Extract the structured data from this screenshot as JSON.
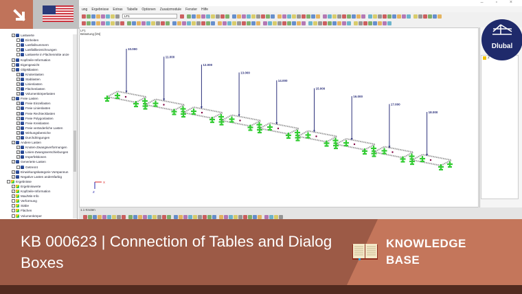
{
  "window": {
    "controls": "– ▫ ×"
  },
  "menu": [
    "ung",
    "Ergebnisse",
    "Extras",
    "Tabelle",
    "Optionen",
    "Zusatzmodule",
    "Fenster",
    "Hilfe"
  ],
  "toolbar": {
    "loadcase": "LF1"
  },
  "tree": [
    {
      "level": 1,
      "label": "Lastwerte",
      "checked": true,
      "icon": "load"
    },
    {
      "level": 2,
      "label": "Einheiten",
      "checked": false,
      "icon": "load"
    },
    {
      "level": 2,
      "label": "Lastfallnummern",
      "checked": false,
      "icon": "load"
    },
    {
      "level": 2,
      "label": "Lastfallbezeichnungen",
      "checked": false,
      "icon": "load"
    },
    {
      "level": 2,
      "label": "Lastwerte in Flächenmitte anze",
      "checked": false,
      "icon": "load"
    },
    {
      "level": 1,
      "label": "Kopfzeile-Information",
      "checked": true,
      "icon": "load"
    },
    {
      "level": 1,
      "label": "Eigengewicht",
      "checked": false,
      "icon": "load"
    },
    {
      "level": 1,
      "label": "Objektlasten",
      "checked": true,
      "icon": "load"
    },
    {
      "level": 2,
      "label": "Knotenlasten",
      "checked": true,
      "icon": "load"
    },
    {
      "level": 2,
      "label": "Stablasten",
      "checked": true,
      "icon": "load"
    },
    {
      "level": 2,
      "label": "Linienlasten",
      "checked": true,
      "icon": "load"
    },
    {
      "level": 2,
      "label": "Flächenlasten",
      "checked": true,
      "icon": "load"
    },
    {
      "level": 2,
      "label": "Volumenkörperlasten",
      "checked": true,
      "icon": "load"
    },
    {
      "level": 1,
      "label": "Freie Lasten",
      "checked": true,
      "icon": "load"
    },
    {
      "level": 2,
      "label": "Freie Einzellasten",
      "checked": true,
      "icon": "load"
    },
    {
      "level": 2,
      "label": "Freie Linienlasten",
      "checked": true,
      "icon": "load"
    },
    {
      "level": 2,
      "label": "Freie Rechtecklasten",
      "checked": true,
      "icon": "load"
    },
    {
      "level": 2,
      "label": "Freie Polygonlasten",
      "checked": true,
      "icon": "load"
    },
    {
      "level": 2,
      "label": "Freie Kreislasten",
      "checked": true,
      "icon": "load"
    },
    {
      "level": 2,
      "label": "Freie veränderliche Lasten",
      "checked": true,
      "icon": "load"
    },
    {
      "level": 2,
      "label": "Wirkungsbereiche",
      "checked": true,
      "icon": "load"
    },
    {
      "level": 2,
      "label": "Durchdringungen",
      "checked": true,
      "icon": "load"
    },
    {
      "level": 1,
      "label": "Andere Lasten",
      "checked": true,
      "icon": "load"
    },
    {
      "level": 2,
      "label": "Knoten-Zwangsverformungen",
      "checked": true,
      "icon": "load"
    },
    {
      "level": 2,
      "label": "Linien-Zwangsverschiebungen",
      "checked": true,
      "icon": "load"
    },
    {
      "level": 2,
      "label": "Imperfektionen",
      "checked": true,
      "icon": "load"
    },
    {
      "level": 1,
      "label": "Generierte Lasten",
      "checked": true,
      "icon": "load"
    },
    {
      "level": 2,
      "label": "Getrennt",
      "checked": false,
      "icon": "load"
    },
    {
      "level": 1,
      "label": "Einwirkungskategorie Vorspannun",
      "checked": true,
      "icon": "load"
    },
    {
      "level": 1,
      "label": "Negative Lasten andersfarbig",
      "checked": true,
      "icon": "load"
    },
    {
      "level": 0,
      "label": "Ergebnisse",
      "checked": false,
      "icon": "result"
    },
    {
      "level": 1,
      "label": "Ergebniswerte",
      "checked": true,
      "icon": "result"
    },
    {
      "level": 1,
      "label": "Kopfzeile-Information",
      "checked": true,
      "icon": "result"
    },
    {
      "level": 1,
      "label": "Max/Min-Info",
      "checked": true,
      "icon": "result"
    },
    {
      "level": 1,
      "label": "Verformung",
      "checked": false,
      "icon": "result"
    },
    {
      "level": 1,
      "label": "Stäbe",
      "checked": false,
      "icon": "result"
    },
    {
      "level": 1,
      "label": "Flächen",
      "checked": false,
      "icon": "result"
    },
    {
      "level": 1,
      "label": "Volumenkörper",
      "checked": false,
      "icon": "result"
    }
  ],
  "canvas": {
    "caption_line1": "LF1",
    "caption_line2": "Belastung [kN]",
    "loads": [
      "10.000",
      "11.000",
      "12.000",
      "13.000",
      "14.000",
      "15.000",
      "16.000",
      "17.000",
      "18.000"
    ],
    "axis_x": "X",
    "axis_z": "Z"
  },
  "bottom_panel": {
    "label": "1.1 Knoten"
  },
  "right_panel": {
    "item": "2"
  },
  "logo": {
    "text": "Dlubal"
  },
  "banner": {
    "title": "KB 000623 | Connection of Tables and Dialog Boxes",
    "category_line1": "KNOWLEDGE",
    "category_line2": "BASE"
  },
  "colors": {
    "banner_left": "#9c5a46",
    "banner_right": "#c4765b",
    "logo_bg": "#1f2a6b",
    "load_arrow": "#2a2f7a",
    "support": "#33cc33"
  }
}
